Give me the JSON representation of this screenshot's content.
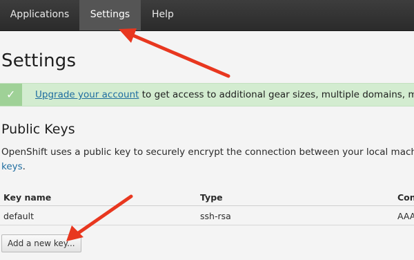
{
  "nav": {
    "tabs": [
      {
        "label": "Applications"
      },
      {
        "label": "Settings",
        "active": true
      },
      {
        "label": "Help"
      }
    ]
  },
  "page": {
    "title": "Settings"
  },
  "alert": {
    "icon": "check-icon",
    "link_text": "Upgrade your account",
    "text": " to get access to additional gear sizes, multiple domains, more"
  },
  "public_keys": {
    "title": "Public Keys",
    "description_line1": "OpenShift uses a public key to securely encrypt the connection between your local machine a",
    "description_link": "keys",
    "description_end": ".",
    "table": {
      "columns": [
        "Key name",
        "Type",
        "Con"
      ],
      "rows": [
        [
          "default",
          "ssh-rsa",
          "AAA"
        ]
      ]
    },
    "add_button_label": "Add a new key..."
  },
  "colors": {
    "nav_bg": "#2b2b2b",
    "nav_active": "#555555",
    "alert_bg": "#d3ecd0",
    "link": "#1f6da0",
    "annotation_arrow": "#e8371f"
  }
}
